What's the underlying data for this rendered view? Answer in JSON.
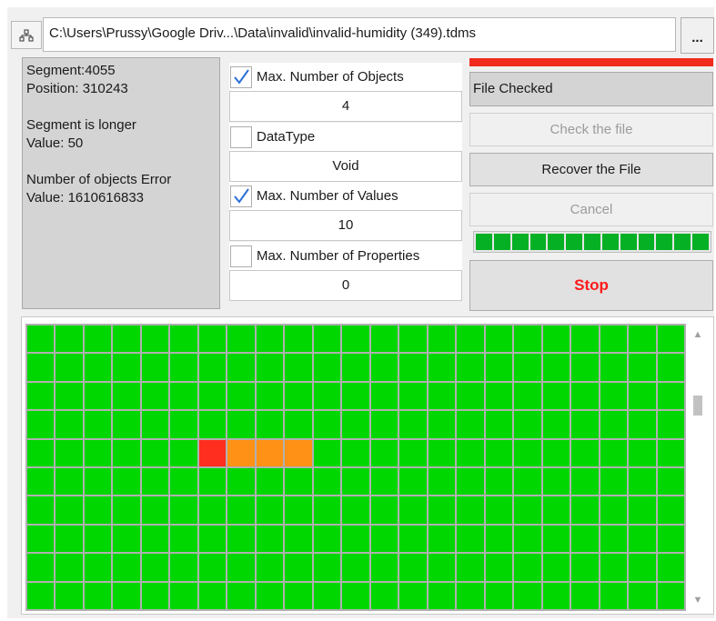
{
  "path": {
    "value": "C:\\Users\\Prussy\\Google Driv...\\Data\\invalid\\invalid-humidity (349).tdms",
    "browse_label": "...",
    "tree_icon": "hierarchy-icon"
  },
  "info": {
    "segment": "Segment:4055",
    "position": "Position: 310243",
    "longer": "Segment is longer",
    "longer_value": "Value: 50",
    "objects_error": "Number of objects Error",
    "objects_value": "Value: 1610616833"
  },
  "options": [
    {
      "label": "Max. Number of Objects",
      "checked": true,
      "value": "4"
    },
    {
      "label": "DataType",
      "checked": false,
      "value": "Void"
    },
    {
      "label": "Max. Number of Values",
      "checked": true,
      "value": "10"
    },
    {
      "label": "Max. Number of Properties",
      "checked": false,
      "value": "0"
    }
  ],
  "status": {
    "text": "File Checked",
    "indicator_color": "#f02a1c"
  },
  "buttons": {
    "check": "Check the file",
    "recover": "Recover the File",
    "cancel": "Cancel",
    "stop": "Stop"
  },
  "progress": {
    "fraction": 1.0,
    "segments": 13,
    "color": "#06b025"
  },
  "grid": {
    "rows": 10,
    "cols": 23,
    "default_color": "#00d700",
    "highlights": [
      {
        "row": 4,
        "col": 6,
        "color": "#ff2e1f"
      },
      {
        "row": 4,
        "col": 7,
        "color": "#ff9216"
      },
      {
        "row": 4,
        "col": 8,
        "color": "#ff9216"
      },
      {
        "row": 4,
        "col": 9,
        "color": "#ff9216"
      }
    ]
  }
}
